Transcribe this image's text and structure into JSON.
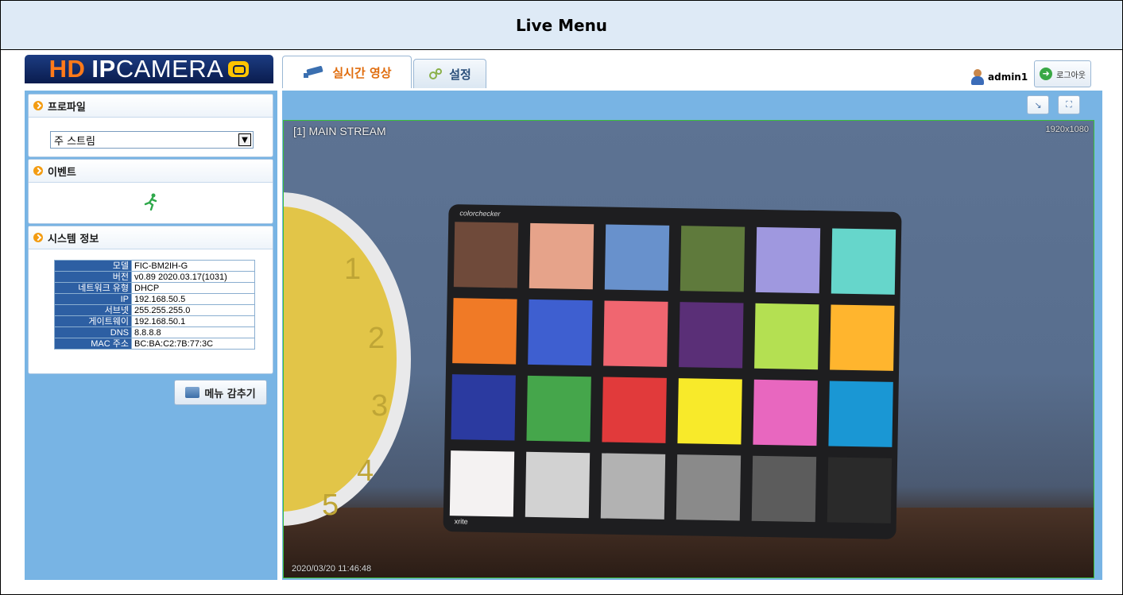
{
  "banner": {
    "title": "Live Menu"
  },
  "logo": {
    "hd": "HD",
    "ip": "IP",
    "camera": "CAMERA"
  },
  "tabs": [
    {
      "label": "실시간 영상",
      "icon": "camera-icon",
      "active": true
    },
    {
      "label": "설정",
      "icon": "gears-icon",
      "active": false
    }
  ],
  "user": {
    "name": "admin1"
  },
  "logout": {
    "label": "로그아웃"
  },
  "profile": {
    "title": "프로파일",
    "selected": "주 스트림"
  },
  "event": {
    "title": "이벤트",
    "icon": "running-person-icon"
  },
  "system_info": {
    "title": "시스템 정보",
    "rows": [
      {
        "key": "모델",
        "value": "FIC-BM2IH-G"
      },
      {
        "key": "버전",
        "value": "v0.89 2020.03.17(1031)"
      },
      {
        "key": "네트워크 유형",
        "value": "DHCP"
      },
      {
        "key": "IP",
        "value": "192.168.50.5"
      },
      {
        "key": "서브넷",
        "value": "255.255.255.0"
      },
      {
        "key": "게이트웨이",
        "value": "192.168.50.1"
      },
      {
        "key": "DNS",
        "value": "8.8.8.8"
      },
      {
        "key": "MAC 주소",
        "value": "BC:BA:C2:7B:77:3C"
      }
    ]
  },
  "hide_menu": {
    "label": "메뉴 감추기"
  },
  "video": {
    "stream_title": "[1] MAIN STREAM",
    "resolution": "1920x1080",
    "timestamp": "2020/03/20 11:46:48",
    "chart_brand": "colorchecker",
    "chart_footer": "xrite"
  },
  "colors": {
    "accent_orange": "#e06d0e",
    "panel_blue": "#78b4e4",
    "table_key_blue": "#2d5fa3",
    "video_border": "#3bbf3b"
  }
}
